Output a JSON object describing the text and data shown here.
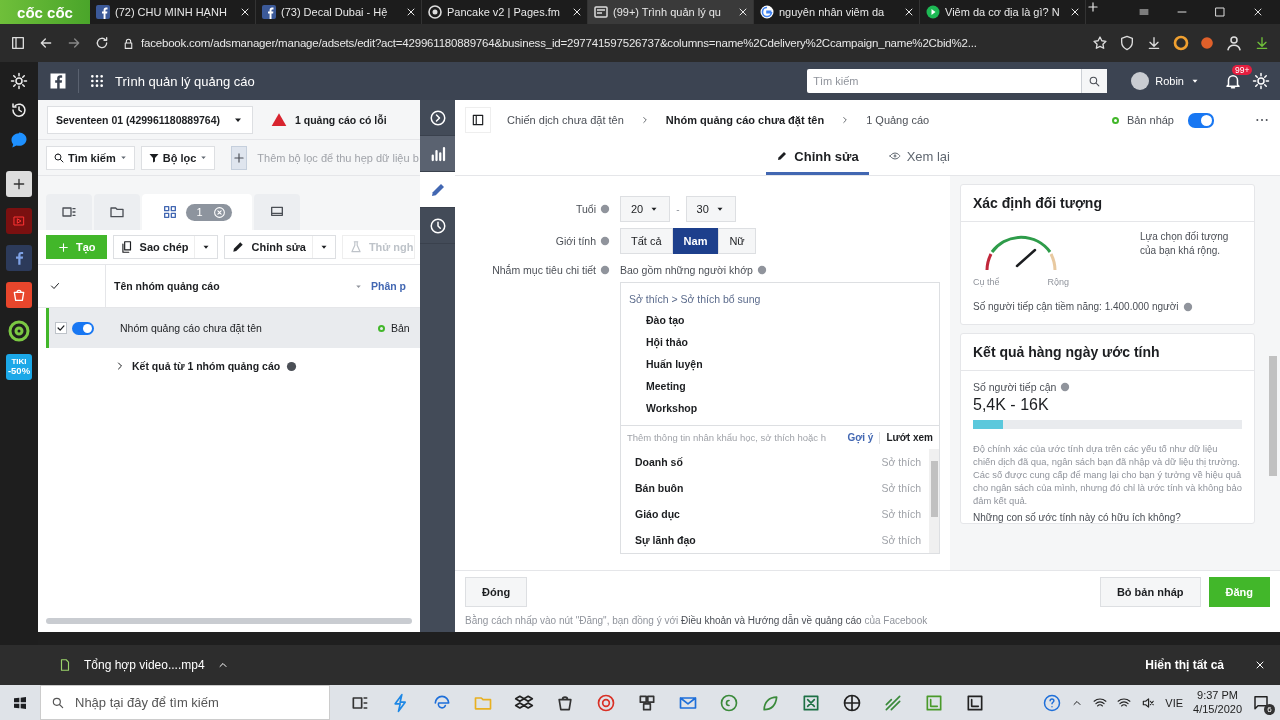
{
  "browser": {
    "brand": "cốc cốc",
    "tabs": [
      {
        "title": "(72) CHU MINH HẠNH",
        "selected": false
      },
      {
        "title": "(73) Decal Dubai - Hệ",
        "selected": false
      },
      {
        "title": "Pancake v2 | Pages.fm",
        "selected": false
      },
      {
        "title": "(99+) Trình quản lý qu",
        "selected": true
      },
      {
        "title": "nguyên nhân viêm da",
        "selected": false
      },
      {
        "title": "Viêm da cơ địa là gì? N",
        "selected": false
      }
    ],
    "url": "facebook.com/adsmanager/manage/adsets/edit?act=429961180889764&business_id=297741597526737&columns=name%2Cdelivery%2Ccampaign_name%2Cbid%2...",
    "sidebar_badge": {
      "line_1": "TIKI",
      "line_2": "-50%"
    }
  },
  "header": {
    "title": "Trình quản lý quảng cáo",
    "search": {
      "placeholder": "Tìm kiếm"
    },
    "user": "Robin",
    "notifications": "99+"
  },
  "account": {
    "name": "Seventeen 01 (429961180889764)",
    "error": "1 quảng cáo có lỗi"
  },
  "filters": {
    "search": "Tìm kiếm",
    "filter": "Bộ lọc",
    "placeholder": "Thêm bộ lọc để thu hẹp dữ liệu b"
  },
  "view_tabs": [
    {
      "selected": false
    },
    {
      "selected": false
    },
    {
      "selected": true,
      "count": "1"
    },
    {
      "selected": false
    }
  ],
  "actions": [
    {
      "label": "Tạo",
      "kind": "primary"
    },
    {
      "label": "Sao chép",
      "kind": "split"
    },
    {
      "label": "Chỉnh sửa",
      "kind": "split"
    },
    {
      "label": "Thử ngh",
      "kind": "disabled"
    }
  ],
  "table": {
    "all_checked": true,
    "columns": [
      "Tên nhóm quảng cáo",
      "Phân p"
    ],
    "rows": [
      {
        "checked": true,
        "on": true,
        "name": "Nhóm quảng cáo chưa đặt tên",
        "status": "Bản"
      }
    ],
    "summary": "Kết quả từ 1 nhóm quảng cáo"
  },
  "side_tools": [
    {
      "selected": false
    },
    {
      "selected": false
    },
    {
      "selected": true
    },
    {
      "selected": false
    }
  ],
  "editor": {
    "breadcrumb": [
      {
        "label": "Chiến dịch chưa đặt tên",
        "current": false
      },
      {
        "label": "Nhóm quảng cáo chưa đặt tên",
        "current": true
      },
      {
        "label": "1 Quảng cáo",
        "current": false
      }
    ],
    "status": "Bản nháp",
    "status_on": true,
    "tabs": [
      {
        "label": "Chỉnh sửa",
        "kind": "edit",
        "selected": true
      },
      {
        "label": "Xem lại",
        "kind": "review",
        "selected": false
      }
    ]
  },
  "form": {
    "age": {
      "label": "Tuổi",
      "min": "20",
      "separator": "-",
      "max": "30"
    },
    "gender": {
      "label": "Giới tính",
      "options": [
        {
          "label": "Tất cả",
          "selected": false
        },
        {
          "label": "Nam",
          "selected": true
        },
        {
          "label": "Nữ",
          "selected": false
        }
      ]
    },
    "detailed": {
      "label": "Nhắm mục tiêu chi tiết",
      "include_label": "Bao gồm những người khớp",
      "category": "Sở thích > Sở thích bổ sung",
      "items": [
        "Đào tạo",
        "Hội thảo",
        "Huấn luyện",
        "Meeting",
        "Workshop"
      ],
      "search": {
        "placeholder": "Thêm thông tin nhân khẩu học, sở thích hoặc h"
      },
      "suggest": "Gợi ý",
      "browse": "Lướt xem",
      "suggestions": [
        {
          "name": "Doanh số",
          "type": "Sở thích"
        },
        {
          "name": "Bán buôn",
          "type": "Sở thích"
        },
        {
          "name": "Giáo dục",
          "type": "Sở thích"
        },
        {
          "name": "Sự lãnh đạo",
          "type": "Sở thích"
        }
      ]
    }
  },
  "audience": {
    "title": "Xác định đối tượng",
    "specific": "Cụ thể",
    "broad": "Rộng",
    "note": "Lựa chọn đối tượng của bạn khá rộng.",
    "potential_reach": "Số người tiếp cận tiềm năng: 1.400.000 người"
  },
  "estimate": {
    "title": "Kết quả hàng ngày ước tính",
    "reach_label": "Số người tiếp cận",
    "reach": "5,4K - 16K",
    "level": 0.11,
    "disclaimer": "Độ chính xác của ước tính dựa trên các yếu tố như dữ liệu chiến dịch đã qua, ngân sách bạn đã nhập và dữ liệu thị trường. Các số được cung cấp để mang lại cho bạn ý tưởng về hiệu quả cho ngân sách của mình, nhưng đó chỉ là ước tính và không bảo đảm kết quả.",
    "feedback": "Những con số ước tính này có hữu ích không?"
  },
  "footer": {
    "close": "Đóng",
    "discard": "Bỏ bản nháp",
    "publish": "Đăng",
    "terms_before": "Bằng cách nhấp vào nút \"Đăng\", bạn đồng ý với",
    "terms_link": "Điều khoản và Hướng dẫn về quảng cáo",
    "terms_after": "của Facebook"
  },
  "downloads": {
    "file": "Tổng hợp video....mp4",
    "show_all": "Hiển thị tất cả"
  },
  "taskbar": {
    "search": {
      "placeholder": "Nhập tại đây để tìm kiếm"
    },
    "language": "VIE",
    "time": "9:37 PM",
    "date": "4/15/2020",
    "notifications": "6"
  }
}
